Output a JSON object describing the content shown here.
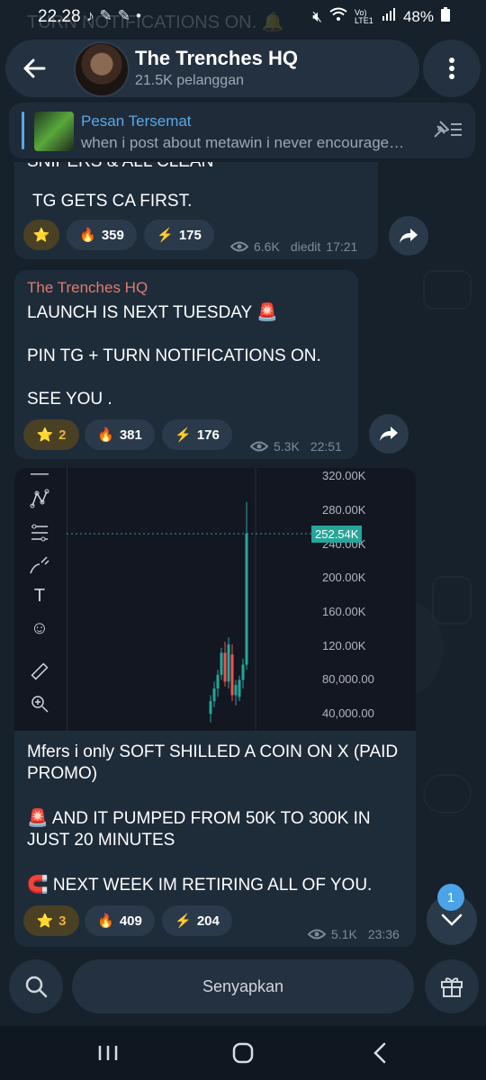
{
  "status_bar": {
    "time": "22.28",
    "battery": "48%",
    "network": "Vo) LTE1",
    "left_icons": [
      "tiktok-icon",
      "pill-icon",
      "pill-icon",
      "dot-icon"
    ],
    "right_icons": [
      "mute-icon",
      "wifi-icon",
      "signal-icon",
      "battery-icon"
    ]
  },
  "background_hint": "TURN NOTIFICATIONS ON. 🔔",
  "header": {
    "title": "The Trenches HQ",
    "subtitle": "21.5K pelanggan"
  },
  "pinned": {
    "title": "Pesan Tersemat",
    "text": "when i post about metawin i never encourage…"
  },
  "messages": [
    {
      "partial_top": "SNIPERS & ALL CLEAN",
      "text": "TG GETS CA FIRST.",
      "reactions": [
        {
          "emoji": "⭐",
          "count": ""
        },
        {
          "emoji": "🔥",
          "count": "359"
        },
        {
          "emoji": "⚡",
          "count": "175"
        }
      ],
      "views": "6.6K",
      "edited": "diedit",
      "time": "17:21"
    },
    {
      "author": "The Trenches HQ",
      "line1": "LAUNCH IS NEXT TUESDAY 🚨",
      "line2": "PIN TG + TURN NOTIFICATIONS ON.",
      "line3": "SEE YOU .",
      "reactions": [
        {
          "emoji": "⭐",
          "count": "2"
        },
        {
          "emoji": "🔥",
          "count": "381"
        },
        {
          "emoji": "⚡",
          "count": "176"
        }
      ],
      "views": "5.3K",
      "time": "22:51"
    },
    {
      "text1": "Mfers i only SOFT SHILLED A COIN ON X (PAID PROMO)",
      "text2": "🚨 AND IT PUMPED FROM 50K TO 300K IN JUST 20 MINUTES",
      "text3": "🧲 NEXT WEEK IM RETIRING ALL OF YOU.",
      "reactions": [
        {
          "emoji": "⭐",
          "count": "3"
        },
        {
          "emoji": "🔥",
          "count": "409"
        },
        {
          "emoji": "⚡",
          "count": "204"
        }
      ],
      "views": "5.1K",
      "time": "23:36"
    }
  ],
  "chart_data": {
    "type": "candlestick",
    "y_tick_labels": [
      "320.00K",
      "280.00K",
      "240.00K",
      "200.00K",
      "160.00K",
      "120.00K",
      "80,000.00",
      "40,000.00"
    ],
    "y_ticks": [
      320000,
      280000,
      240000,
      200000,
      160000,
      120000,
      80000,
      40000
    ],
    "ylim": [
      20000,
      330000
    ],
    "current_price_label": "252.54K",
    "current_price": 252540,
    "candles": [
      {
        "o": 40000,
        "h": 62000,
        "l": 30000,
        "c": 55000
      },
      {
        "o": 55000,
        "h": 78000,
        "l": 48000,
        "c": 70000
      },
      {
        "o": 70000,
        "h": 92000,
        "l": 60000,
        "c": 86000
      },
      {
        "o": 86000,
        "h": 118000,
        "l": 80000,
        "c": 112000
      },
      {
        "o": 112000,
        "h": 125000,
        "l": 72000,
        "c": 78000
      },
      {
        "o": 78000,
        "h": 130000,
        "l": 70000,
        "c": 122000
      },
      {
        "o": 110000,
        "h": 122000,
        "l": 55000,
        "c": 62000
      },
      {
        "o": 62000,
        "h": 80000,
        "l": 50000,
        "c": 74000
      },
      {
        "o": 60000,
        "h": 85000,
        "l": 55000,
        "c": 80000
      },
      {
        "o": 80000,
        "h": 105000,
        "l": 70000,
        "c": 98000
      },
      {
        "o": 98000,
        "h": 290000,
        "l": 92000,
        "c": 252540
      }
    ]
  },
  "unread_badge": "1",
  "bottom": {
    "mute_label": "Senyapkan"
  }
}
